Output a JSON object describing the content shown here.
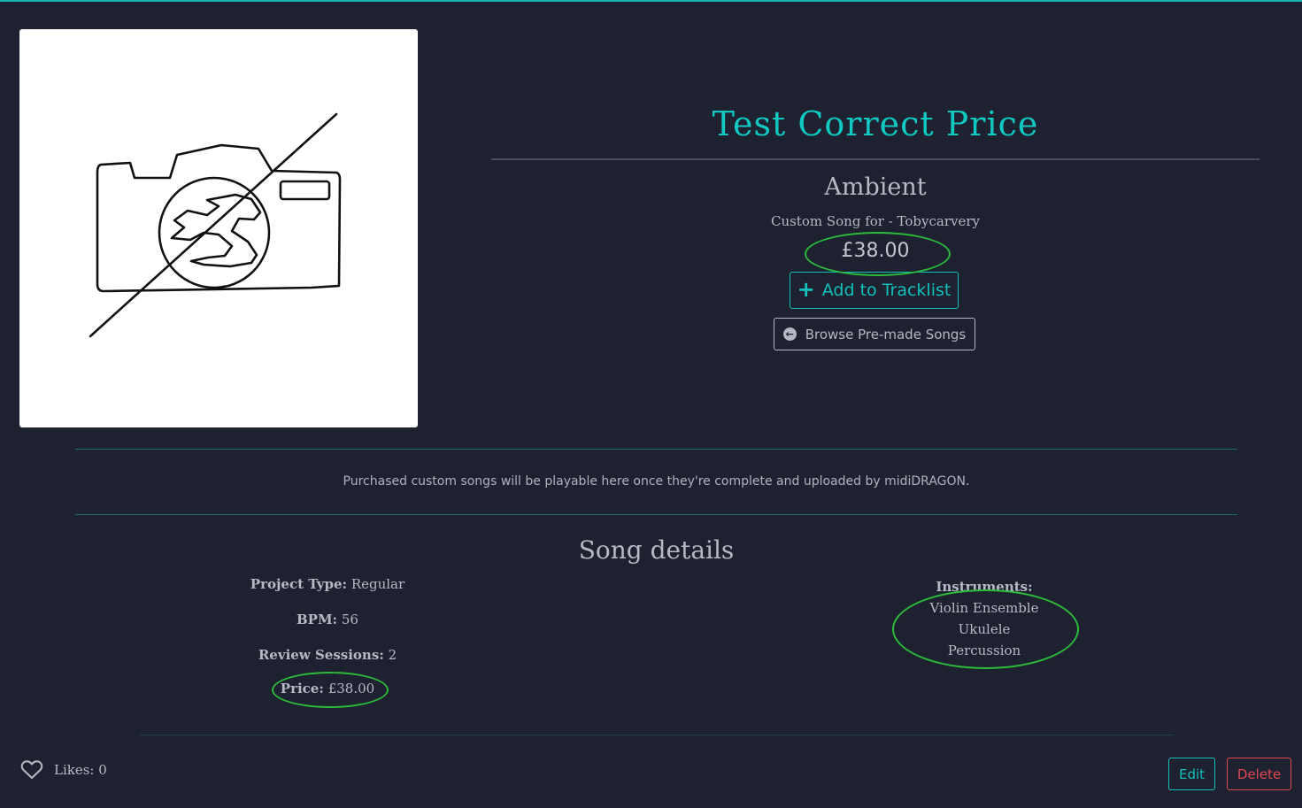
{
  "product": {
    "title": "Test Correct Price",
    "genre": "Ambient",
    "subtitle": "Custom Song for - Tobycarvery",
    "price": "£38.00",
    "add_button_label": "Add to Tracklist",
    "browse_button_label": "Browse Pre-made Songs",
    "image_icon": "no-image-camera-dragon-icon"
  },
  "notice": "Purchased custom songs will be playable here once they're complete and uploaded by midiDRAGON.",
  "details": {
    "heading": "Song details",
    "project_type_label": "Project Type:",
    "project_type_value": "Regular",
    "bpm_label": "BPM:",
    "bpm_value": "56",
    "review_label": "Review Sessions:",
    "review_value": "2",
    "price_label": "Price:",
    "price_value": "£38.00",
    "instruments_label": "Instruments:",
    "instruments": [
      "Violin Ensemble",
      "Ukulele",
      "Percussion"
    ]
  },
  "likes": {
    "label": "Likes:",
    "count": "0"
  },
  "actions": {
    "edit_label": "Edit",
    "delete_label": "Delete"
  },
  "colors": {
    "background": "#1d2130",
    "accent": "#10c9c3",
    "danger": "#e0484f",
    "annotation": "#2dbb3c"
  }
}
